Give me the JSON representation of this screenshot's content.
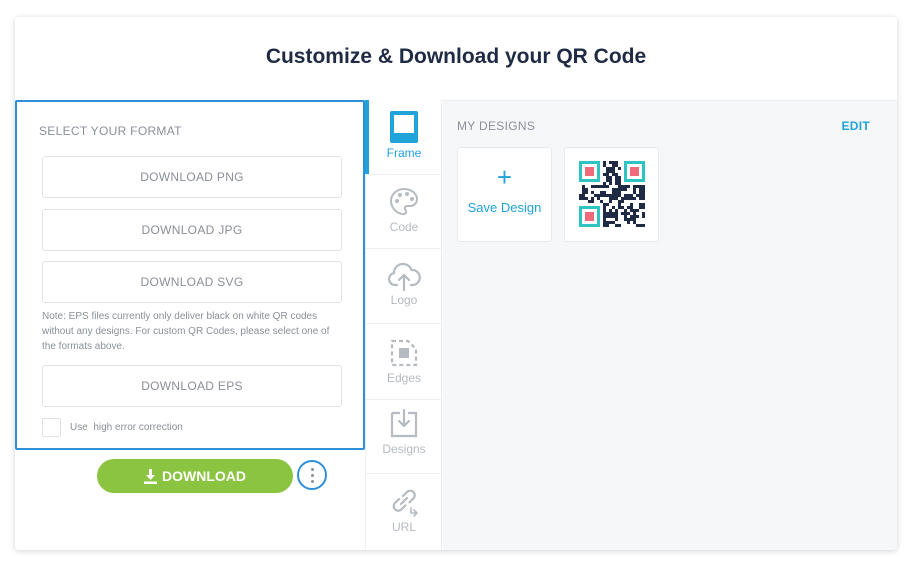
{
  "title": "Customize & Download your QR Code",
  "format": {
    "heading": "SELECT YOUR FORMAT",
    "png_label": "DOWNLOAD PNG",
    "jpg_label": "DOWNLOAD JPG",
    "svg_label": "DOWNLOAD SVG",
    "note": "Note: EPS files currently only deliver black on white QR codes without any designs. For custom QR Codes, please select one of the formats above.",
    "eps_label": "DOWNLOAD EPS",
    "error_correction_label": "Use  high error correction",
    "error_correction_checked": false
  },
  "actions": {
    "download_label": "DOWNLOAD"
  },
  "tabs": [
    {
      "label": "Frame",
      "icon": "frame-icon",
      "active": true
    },
    {
      "label": "Code",
      "icon": "palette-icon",
      "active": false
    },
    {
      "label": "Logo",
      "icon": "cloud-upload-icon",
      "active": false
    },
    {
      "label": "Edges",
      "icon": "edges-icon",
      "active": false
    },
    {
      "label": "Designs",
      "icon": "designs-icon",
      "active": false
    },
    {
      "label": "URL",
      "icon": "link-icon",
      "active": false
    }
  ],
  "designs": {
    "heading": "MY DESIGNS",
    "edit_label": "EDIT",
    "save_label": "Save Design",
    "plus_symbol": "+"
  },
  "colors": {
    "accent": "#1fa3d9",
    "panel_border": "#2f8fd8",
    "download_green": "#8ac441",
    "qr_teal": "#2ec4c4",
    "qr_pink": "#ef6a7a",
    "qr_dark": "#1f2a44"
  }
}
